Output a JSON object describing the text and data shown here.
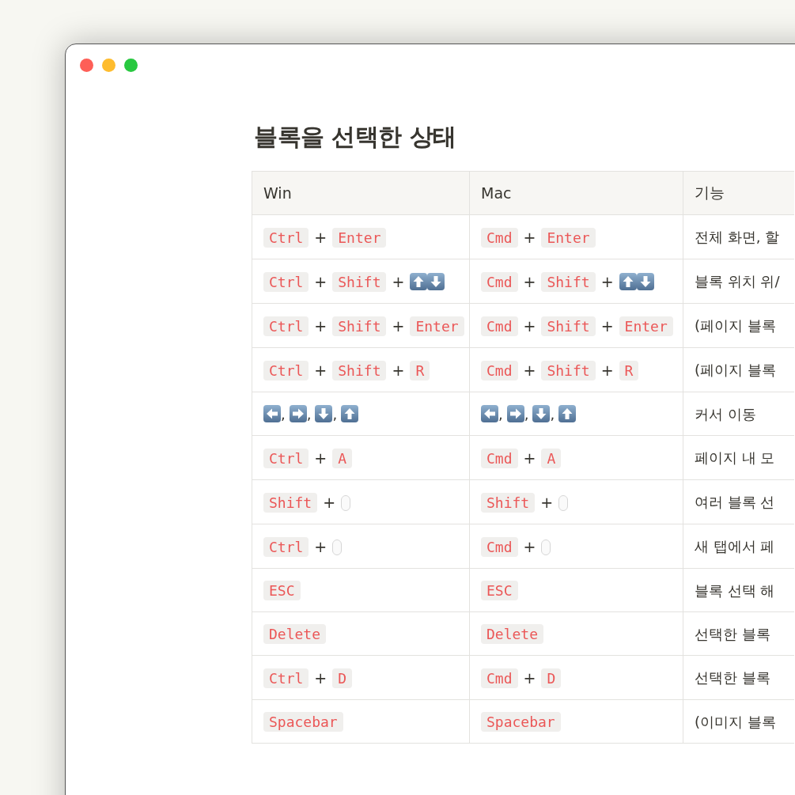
{
  "title": "블록을 선택한 상태",
  "table": {
    "columns": [
      "Win",
      "Mac",
      "기능"
    ],
    "rows": [
      {
        "win": [
          {
            "kind": "key",
            "text": "Ctrl"
          },
          {
            "kind": "sep",
            "text": "+"
          },
          {
            "kind": "key",
            "text": "Enter"
          }
        ],
        "mac": [
          {
            "kind": "key",
            "text": "Cmd"
          },
          {
            "kind": "sep",
            "text": "+"
          },
          {
            "kind": "key",
            "text": "Enter"
          }
        ],
        "function": "전체 화면, 할"
      },
      {
        "win": [
          {
            "kind": "key",
            "text": "Ctrl"
          },
          {
            "kind": "sep",
            "text": "+"
          },
          {
            "kind": "key",
            "text": "Shift"
          },
          {
            "kind": "sep",
            "text": "+"
          },
          {
            "kind": "up"
          },
          {
            "kind": "down"
          }
        ],
        "mac": [
          {
            "kind": "key",
            "text": "Cmd"
          },
          {
            "kind": "sep",
            "text": "+"
          },
          {
            "kind": "key",
            "text": "Shift"
          },
          {
            "kind": "sep",
            "text": "+"
          },
          {
            "kind": "up"
          },
          {
            "kind": "down"
          }
        ],
        "function": "블록 위치 위/"
      },
      {
        "win": [
          {
            "kind": "key",
            "text": "Ctrl"
          },
          {
            "kind": "sep",
            "text": "+"
          },
          {
            "kind": "key",
            "text": "Shift"
          },
          {
            "kind": "sep",
            "text": "+"
          },
          {
            "kind": "key",
            "text": "Enter"
          }
        ],
        "mac": [
          {
            "kind": "key",
            "text": "Cmd"
          },
          {
            "kind": "sep",
            "text": "+"
          },
          {
            "kind": "key",
            "text": "Shift"
          },
          {
            "kind": "sep",
            "text": "+"
          },
          {
            "kind": "key",
            "text": "Enter"
          }
        ],
        "function": "(페이지 블록"
      },
      {
        "win": [
          {
            "kind": "key",
            "text": "Ctrl"
          },
          {
            "kind": "sep",
            "text": "+"
          },
          {
            "kind": "key",
            "text": "Shift"
          },
          {
            "kind": "sep",
            "text": "+"
          },
          {
            "kind": "key",
            "text": "R"
          }
        ],
        "mac": [
          {
            "kind": "key",
            "text": "Cmd"
          },
          {
            "kind": "sep",
            "text": "+"
          },
          {
            "kind": "key",
            "text": "Shift"
          },
          {
            "kind": "sep",
            "text": "+"
          },
          {
            "kind": "key",
            "text": "R"
          }
        ],
        "function": "(페이지 블록"
      },
      {
        "win": [
          {
            "kind": "left"
          },
          {
            "kind": "comma",
            "text": ","
          },
          {
            "kind": "right"
          },
          {
            "kind": "comma",
            "text": ","
          },
          {
            "kind": "down"
          },
          {
            "kind": "comma",
            "text": ","
          },
          {
            "kind": "up"
          }
        ],
        "mac": [
          {
            "kind": "left"
          },
          {
            "kind": "comma",
            "text": ","
          },
          {
            "kind": "right"
          },
          {
            "kind": "comma",
            "text": ","
          },
          {
            "kind": "down"
          },
          {
            "kind": "comma",
            "text": ","
          },
          {
            "kind": "up"
          }
        ],
        "function": "커서 이동"
      },
      {
        "win": [
          {
            "kind": "key",
            "text": "Ctrl"
          },
          {
            "kind": "sep",
            "text": "+"
          },
          {
            "kind": "key",
            "text": "A"
          }
        ],
        "mac": [
          {
            "kind": "key",
            "text": "Cmd"
          },
          {
            "kind": "sep",
            "text": "+"
          },
          {
            "kind": "key",
            "text": "A"
          }
        ],
        "function": "페이지 내 모"
      },
      {
        "win": [
          {
            "kind": "key",
            "text": "Shift"
          },
          {
            "kind": "sep",
            "text": "+"
          },
          {
            "kind": "mouse"
          }
        ],
        "mac": [
          {
            "kind": "key",
            "text": "Shift"
          },
          {
            "kind": "sep",
            "text": "+"
          },
          {
            "kind": "mouse"
          }
        ],
        "function": "여러 블록 선"
      },
      {
        "win": [
          {
            "kind": "key",
            "text": "Ctrl"
          },
          {
            "kind": "sep",
            "text": "+"
          },
          {
            "kind": "mouse"
          }
        ],
        "mac": [
          {
            "kind": "key",
            "text": "Cmd"
          },
          {
            "kind": "sep",
            "text": "+"
          },
          {
            "kind": "mouse"
          }
        ],
        "function": "새 탭에서 페"
      },
      {
        "win": [
          {
            "kind": "key",
            "text": "ESC"
          }
        ],
        "mac": [
          {
            "kind": "key",
            "text": "ESC"
          }
        ],
        "function": "블록 선택 해"
      },
      {
        "win": [
          {
            "kind": "key",
            "text": "Delete"
          }
        ],
        "mac": [
          {
            "kind": "key",
            "text": "Delete"
          }
        ],
        "function": "선택한 블록"
      },
      {
        "win": [
          {
            "kind": "key",
            "text": "Ctrl"
          },
          {
            "kind": "sep",
            "text": "+"
          },
          {
            "kind": "key",
            "text": "D"
          }
        ],
        "mac": [
          {
            "kind": "key",
            "text": "Cmd"
          },
          {
            "kind": "sep",
            "text": "+"
          },
          {
            "kind": "key",
            "text": "D"
          }
        ],
        "function": "선택한 블록"
      },
      {
        "win": [
          {
            "kind": "key",
            "text": "Spacebar"
          }
        ],
        "mac": [
          {
            "kind": "key",
            "text": "Spacebar"
          }
        ],
        "function": "(이미지 블록"
      }
    ]
  }
}
